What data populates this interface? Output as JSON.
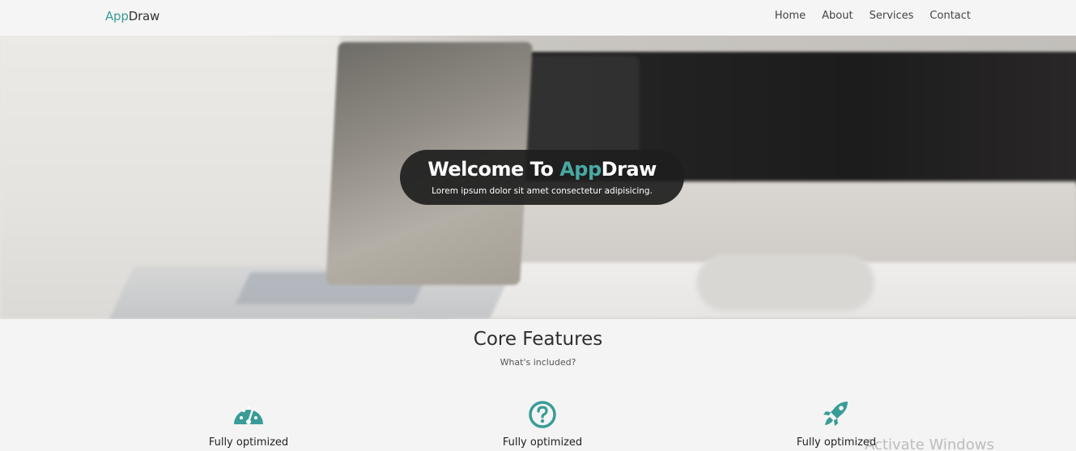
{
  "navbar": {
    "brand_accent": "App",
    "brand_rest": "Draw",
    "links": [
      "Home",
      "About",
      "Services",
      "Contact"
    ]
  },
  "hero": {
    "title_prefix": "Welcome To ",
    "title_accent": "App",
    "title_rest": "Draw",
    "subtitle": "Lorem ipsum dolor sit amet consectetur adipisicing."
  },
  "features": {
    "title": "Core Features",
    "subtitle": "What's included?",
    "items": [
      {
        "icon": "speedometer-icon",
        "label": "Fully optimized"
      },
      {
        "icon": "question-circle-icon",
        "label": "Fully optimized"
      },
      {
        "icon": "rocket-icon",
        "label": "Fully optimized"
      }
    ]
  },
  "watermark": "Activate Windows",
  "colors": {
    "accent": "#3a9c98",
    "nav_bg": "#f5f5f5",
    "welcome_bg": "#1e1e1e",
    "page_bg": "#f4f4f4"
  }
}
